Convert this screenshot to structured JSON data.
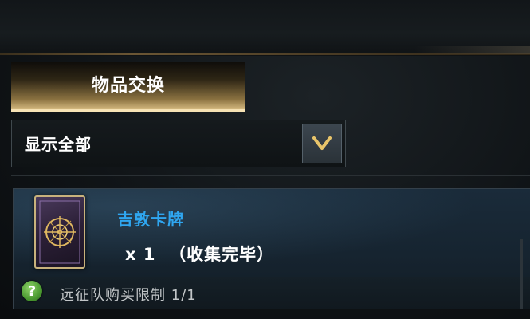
{
  "tab": {
    "label": "物品交换"
  },
  "filter": {
    "selected": "显示全部"
  },
  "item": {
    "name": "吉敦卡牌",
    "quantity": "x 1  （收集完毕）",
    "limit": "远征队购买限制 1/1"
  },
  "icons": {
    "dropdown": "chevron-down-icon",
    "help": "question-icon",
    "card_art": "card-image"
  },
  "colors": {
    "item_name": "#2fa6f0",
    "tab_gold": "#e5c98e",
    "help_green": "#4b9a31"
  }
}
